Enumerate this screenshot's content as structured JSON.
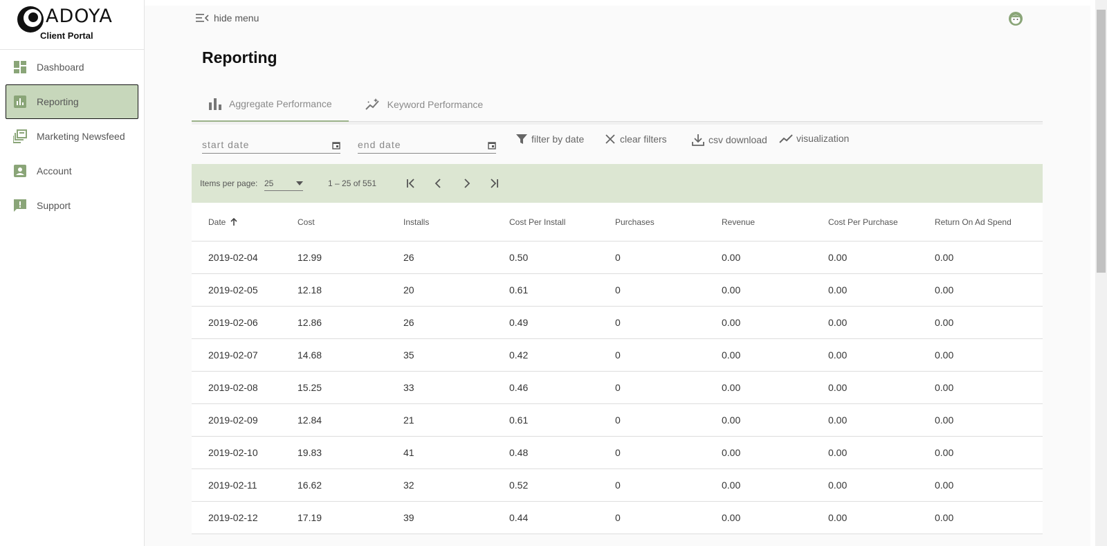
{
  "logo": {
    "word": "ADOYA",
    "subtitle": "Client Portal"
  },
  "sidebar": {
    "items": [
      {
        "label": "Dashboard",
        "icon": "dashboard-icon"
      },
      {
        "label": "Reporting",
        "icon": "bar-chart-icon",
        "active": true
      },
      {
        "label": "Marketing Newsfeed",
        "icon": "library-icon"
      },
      {
        "label": "Account",
        "icon": "account-box-icon"
      },
      {
        "label": "Support",
        "icon": "feedback-icon"
      }
    ]
  },
  "topbar": {
    "hide_menu_label": "hide menu",
    "avatar_icon": "user-avatar-icon"
  },
  "page": {
    "title": "Reporting"
  },
  "tabs": [
    {
      "label": "Aggregate Performance",
      "icon": "bar-chart-icon",
      "active": true
    },
    {
      "label": "Keyword Performance",
      "icon": "insights-icon"
    }
  ],
  "filters": {
    "start_date_placeholder": "start date",
    "end_date_placeholder": "end date",
    "filter_by_date": "filter by date",
    "clear_filters": "clear filters",
    "csv_download": "csv download",
    "visualization": "visualization"
  },
  "paginator": {
    "items_per_page_label": "Items per page:",
    "items_per_page_value": "25",
    "range_label": "1 – 25 of 551"
  },
  "table": {
    "headers": [
      "Date",
      "Cost",
      "Installs",
      "Cost Per Install",
      "Purchases",
      "Revenue",
      "Cost Per Purchase",
      "Return On Ad Spend"
    ],
    "rows": [
      [
        "2019-02-04",
        "12.99",
        "26",
        "0.50",
        "0",
        "0.00",
        "0.00",
        "0.00"
      ],
      [
        "2019-02-05",
        "12.18",
        "20",
        "0.61",
        "0",
        "0.00",
        "0.00",
        "0.00"
      ],
      [
        "2019-02-06",
        "12.86",
        "26",
        "0.49",
        "0",
        "0.00",
        "0.00",
        "0.00"
      ],
      [
        "2019-02-07",
        "14.68",
        "35",
        "0.42",
        "0",
        "0.00",
        "0.00",
        "0.00"
      ],
      [
        "2019-02-08",
        "15.25",
        "33",
        "0.46",
        "0",
        "0.00",
        "0.00",
        "0.00"
      ],
      [
        "2019-02-09",
        "12.84",
        "21",
        "0.61",
        "0",
        "0.00",
        "0.00",
        "0.00"
      ],
      [
        "2019-02-10",
        "19.83",
        "41",
        "0.48",
        "0",
        "0.00",
        "0.00",
        "0.00"
      ],
      [
        "2019-02-11",
        "16.62",
        "32",
        "0.52",
        "0",
        "0.00",
        "0.00",
        "0.00"
      ],
      [
        "2019-02-12",
        "17.19",
        "39",
        "0.44",
        "0",
        "0.00",
        "0.00",
        "0.00"
      ]
    ]
  },
  "colors": {
    "accent": "#9bb28a",
    "active_nav": "#c7d7bb",
    "paginator_bg": "#dce6d2"
  }
}
